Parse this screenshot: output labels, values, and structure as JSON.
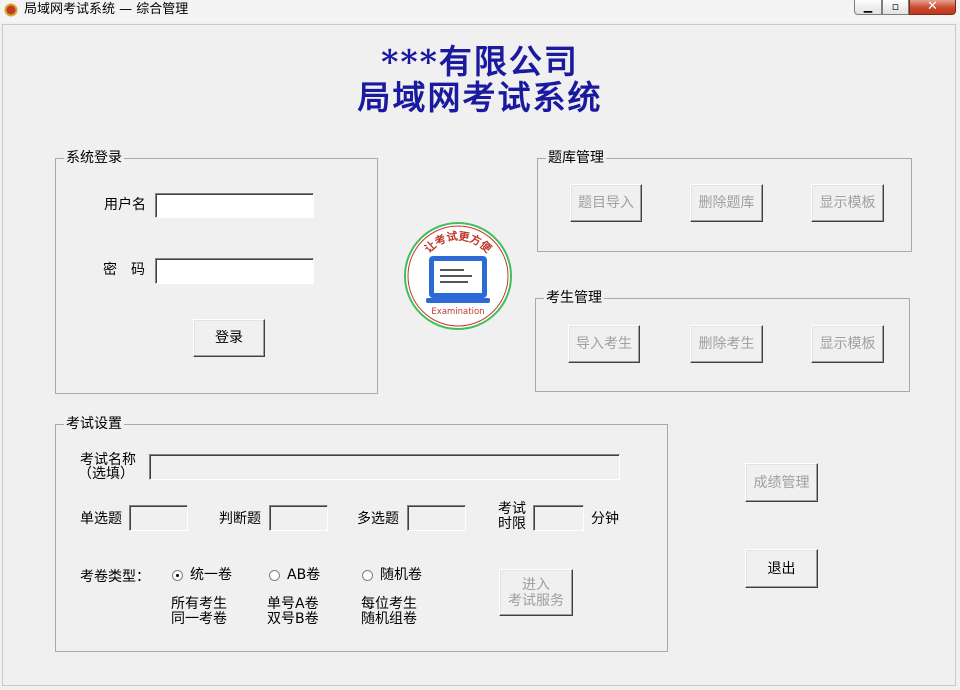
{
  "window": {
    "title": "局域网考试系统 — 综合管理"
  },
  "header": {
    "line1": "***有限公司",
    "line2": "局域网考试系统"
  },
  "login": {
    "group_title": "系统登录",
    "username_label": "用户名",
    "username_value": "",
    "password_label": "密　码",
    "password_value": "",
    "login_button": "登录"
  },
  "question_bank": {
    "group_title": "题库管理",
    "import_button": "题目导入",
    "delete_button": "删除题库",
    "template_button": "显示模板"
  },
  "examinee": {
    "group_title": "考生管理",
    "import_button": "导入考生",
    "delete_button": "删除考生",
    "template_button": "显示模板"
  },
  "logo": {
    "top_text": "让考试更方便",
    "bottom_text": "Examination"
  },
  "exam_settings": {
    "group_title": "考试设置",
    "exam_name_label_1": "考试名称",
    "exam_name_label_2": "（选填）",
    "exam_name_value": "",
    "single_choice_label": "单选题",
    "single_choice_value": "",
    "true_false_label": "判断题",
    "true_false_value": "",
    "multi_choice_label": "多选题",
    "multi_choice_value": "",
    "time_limit_label_1": "考试",
    "time_limit_label_2": "时限",
    "time_limit_value": "",
    "minutes_label": "分钟",
    "paper_type_label": "考卷类型：",
    "paper_types": [
      {
        "label": "统一卷",
        "desc_1": "所有考生",
        "desc_2": "同一考卷",
        "selected": true
      },
      {
        "label": "AB卷",
        "desc_1": "单号A卷",
        "desc_2": "双号B卷",
        "selected": false
      },
      {
        "label": "随机卷",
        "desc_1": "每位考生",
        "desc_2": "随机组卷",
        "selected": false
      }
    ],
    "enter_button_1": "进入",
    "enter_button_2": "考试服务"
  },
  "side": {
    "scores_button": "成绩管理",
    "exit_button": "退出"
  },
  "colors": {
    "heading": "#1a1aa0",
    "logo_red": "#c0392b",
    "logo_blue": "#2c6bd6",
    "logo_green": "#3fbf5a"
  }
}
